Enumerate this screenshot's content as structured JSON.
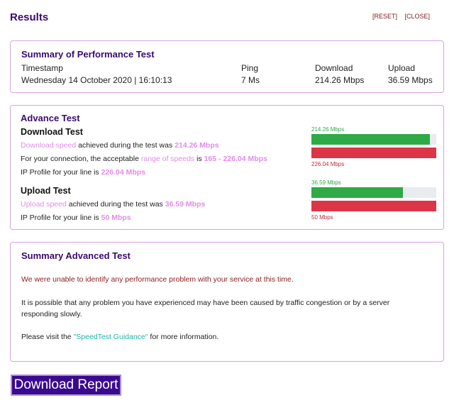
{
  "header": {
    "title": "Results",
    "reset_label": "[RESET]",
    "close_label": "[CLOSE]"
  },
  "summary": {
    "title": "Summary of Performance Test",
    "columns": [
      {
        "label": "Timestamp",
        "value": "Wednesday 14 October 2020 | 16:10:13"
      },
      {
        "label": "Ping",
        "value": "7 Ms"
      },
      {
        "label": "Download",
        "value": "214.26 Mbps"
      },
      {
        "label": "Upload",
        "value": "36.59 Mbps"
      }
    ]
  },
  "advance": {
    "title": "Advance Test",
    "download": {
      "heading": "Download Test",
      "line1_pre": "Download speed",
      "line1_mid": " achieved during the test was ",
      "line1_val": "214.26 Mbps",
      "line2_pre": "For your connection, the acceptable ",
      "line2_link": "range of speeds",
      "line2_mid": " is ",
      "line2_val": "165 - 226.04 Mbps",
      "line3_pre": "IP Profile for your line is ",
      "line3_val": "226.04 Mbps",
      "bar_label_top": "214.26 Mbps",
      "bar_label_bottom": "226.04 Mbps",
      "achieved_fraction": 0.948
    },
    "upload": {
      "heading": "Upload Test",
      "line1_pre": "Upload speed",
      "line1_mid": " achieved during the test was ",
      "line1_val": "36.59 Mbps",
      "line2_pre": "IP Profile for your line is ",
      "line2_val": "50 Mbps",
      "bar_label_top": "36.59 Mbps",
      "bar_label_bottom": "50 Mbps",
      "achieved_fraction": 0.732
    },
    "colors": {
      "achieved": "#2eaa46",
      "profile": "#dc3548",
      "highlight": "#e28ce8"
    }
  },
  "advanced_summary": {
    "title": "Summary Advanced Test",
    "warning": "We were unable to identify any performance problem with your service at this time.",
    "paragraph": "It is possible that any problem you have experienced may have been caused by traffic congestion or by a server responding slowly.",
    "visit_pre": "Please visit the ",
    "visit_link": "\"SpeedTest Guidance\"",
    "visit_post": " for more information."
  },
  "download_button": "Download Report"
}
